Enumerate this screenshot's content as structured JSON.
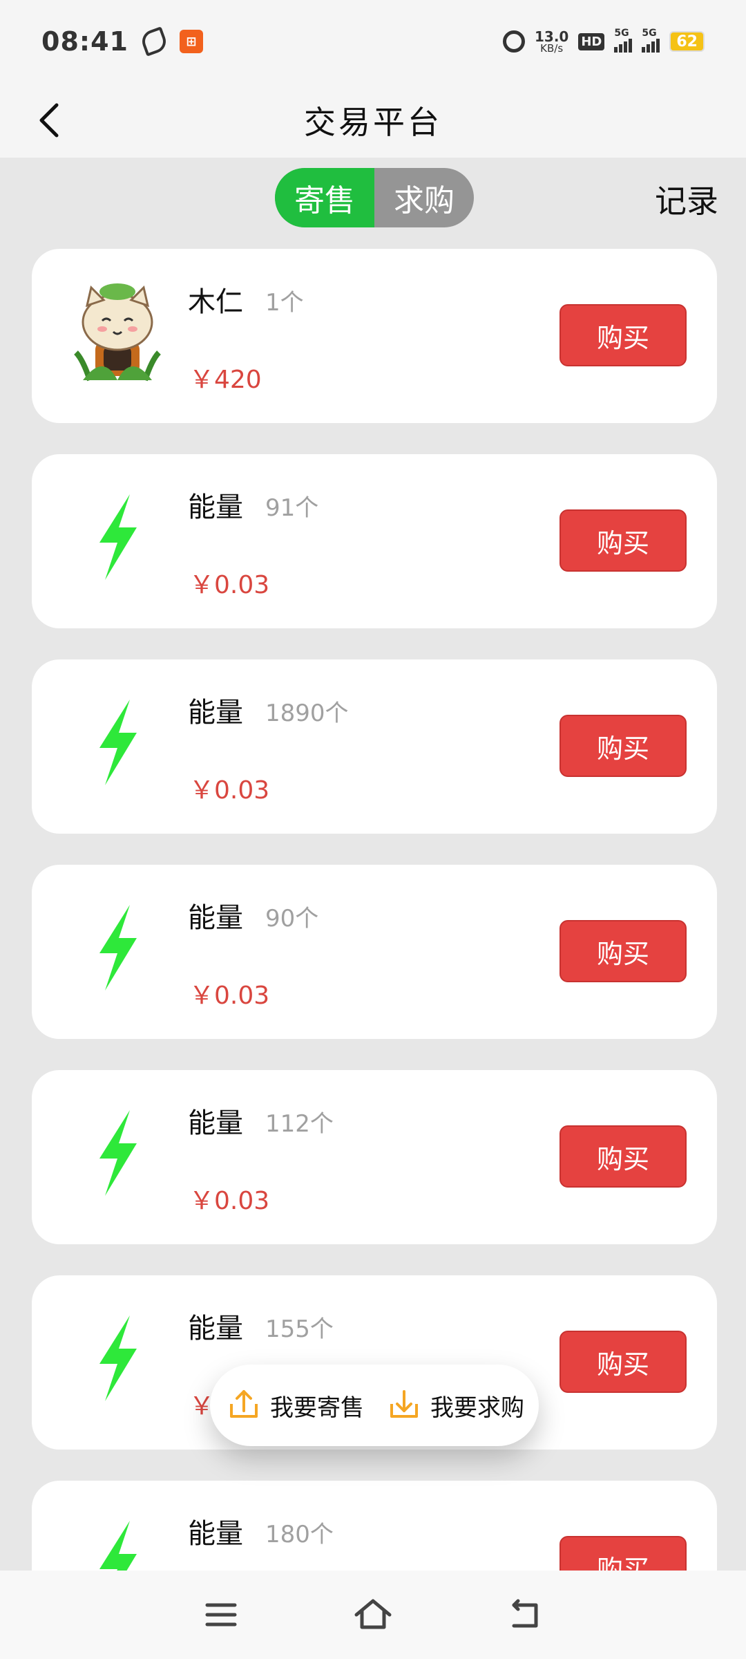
{
  "status_bar": {
    "time": "08:41",
    "speed_value": "13.0",
    "speed_unit": "KB/s",
    "hd_label": "HD",
    "net1": "5G",
    "net2": "5G",
    "battery": "62"
  },
  "header": {
    "title": "交易平台"
  },
  "toggle": {
    "sell": "寄售",
    "buy": "求购"
  },
  "records_label": "记录",
  "items": [
    {
      "name": "木仁",
      "qty": "1个",
      "price": "￥420",
      "buy_label": "购买",
      "icon": "character-icon"
    },
    {
      "name": "能量",
      "qty": "91个",
      "price": "￥0.03",
      "buy_label": "购买",
      "icon": "lightning-icon"
    },
    {
      "name": "能量",
      "qty": "1890个",
      "price": "￥0.03",
      "buy_label": "购买",
      "icon": "lightning-icon"
    },
    {
      "name": "能量",
      "qty": "90个",
      "price": "￥0.03",
      "buy_label": "购买",
      "icon": "lightning-icon"
    },
    {
      "name": "能量",
      "qty": "112个",
      "price": "￥0.03",
      "buy_label": "购买",
      "icon": "lightning-icon"
    },
    {
      "name": "能量",
      "qty": "155个",
      "price": "￥",
      "buy_label": "购买",
      "icon": "lightning-icon"
    },
    {
      "name": "能量",
      "qty": "180个",
      "price": "",
      "buy_label": "购买",
      "icon": "lightning-icon"
    }
  ],
  "float_menu": {
    "sell": "我要寄售",
    "buy": "我要求购"
  },
  "colors": {
    "accent_green": "#20be3f",
    "buy_red": "#e54240",
    "price_red": "#d9463f",
    "lightning_green": "#2ee83a",
    "float_icon_orange": "#f5a623"
  }
}
